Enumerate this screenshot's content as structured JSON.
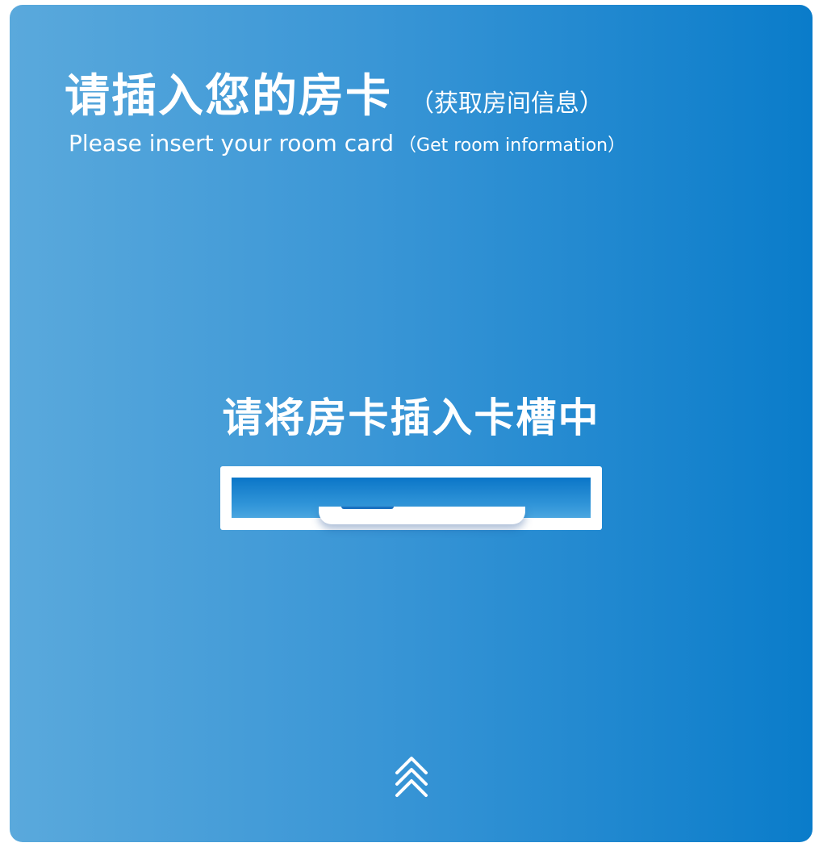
{
  "header": {
    "title_cn": "请插入您的房卡",
    "title_cn_sub": "（获取房间信息）",
    "title_en": "Please insert your room card",
    "title_en_sub": "（Get room information）"
  },
  "main": {
    "instruction": "请将房卡插入卡槽中"
  },
  "icons": {
    "scroll_up": "double-chevron-up-icon"
  },
  "colors": {
    "background_left": "#5aa9dc",
    "background_right": "#0a7cca",
    "text": "#ffffff"
  }
}
